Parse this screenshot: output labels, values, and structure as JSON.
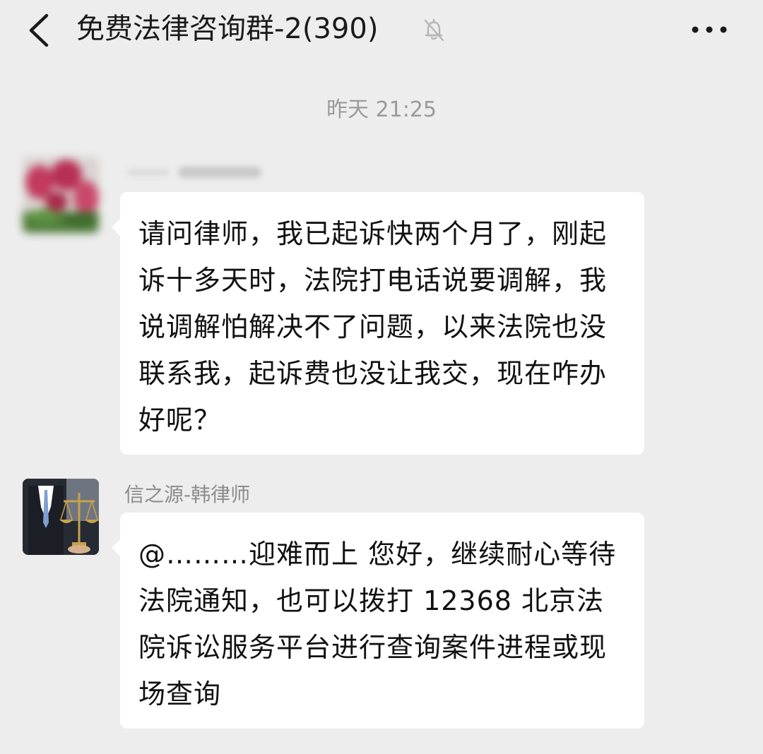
{
  "header": {
    "title": "免费法律咨询群-2(390)",
    "back_icon": "chevron-left-icon",
    "mute_icon": "bell-off-icon",
    "more_icon": "ellipsis-icon"
  },
  "chat": {
    "timestamp": "昨天 21:25",
    "messages": [
      {
        "sender": "",
        "text": "请问律师，我已起诉快两个月了，刚起诉十多天时，法院打电话说要调解，我说调解怕解决不了问题，以来法院也没联系我，起诉费也没让我交，现在咋办好呢？"
      },
      {
        "sender": "信之源-韩律师",
        "text": "@………迎难而上  您好，继续耐心等待法院通知，也可以拨打 12368 北京法院诉讼服务平台进行查询案件进程或现场查询"
      }
    ]
  },
  "colors": {
    "background": "#ededed",
    "bubble": "#ffffff",
    "timestamp": "#9a9a9a",
    "sender_name": "#8c8c8c"
  }
}
